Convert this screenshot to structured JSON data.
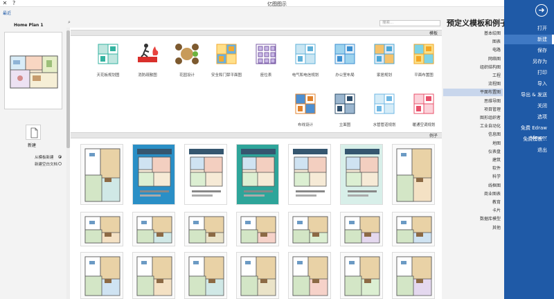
{
  "window": {
    "title": "亿图图示",
    "close_glyph": "✕",
    "help_glyph": "?"
  },
  "sidebar": {
    "back_glyph": "➜",
    "items": [
      {
        "label": "打开"
      },
      {
        "label": "新建",
        "active": true
      },
      {
        "label": "保存"
      },
      {
        "label": "另存为"
      },
      {
        "label": "打印"
      },
      {
        "label": "导入"
      },
      {
        "label": "导出 & 发送"
      },
      {
        "label": "关闭"
      },
      {
        "label": "选项"
      },
      {
        "label": "免费 Edraw Viewer"
      },
      {
        "label": "免费模板..."
      },
      {
        "label": "退出"
      }
    ]
  },
  "categories": {
    "heading": "预定义模板和例子",
    "items": [
      "基本绘图",
      "图表",
      "电路",
      "网络图",
      "组织结构图",
      "工程",
      "流程图",
      "平面布置图",
      "思维导图",
      "项目管理",
      "图形组织者",
      "工业自动化",
      "信息图",
      "地图",
      "仪表盘",
      "建筑",
      "软件",
      "科学",
      "线框图",
      "商业图表",
      "教育",
      "卡片",
      "数据库模型",
      "其他"
    ],
    "active_index": 7
  },
  "search": {
    "placeholder": "搜索..."
  },
  "sections": {
    "templates": "模板",
    "examples": "例子"
  },
  "templates": [
    {
      "label": "平面布置图",
      "kind": "floor"
    },
    {
      "label": "家居规划",
      "kind": "home"
    },
    {
      "label": "办公室布局",
      "kind": "office"
    },
    {
      "label": "电气和电信规划",
      "kind": "electric"
    },
    {
      "label": "座位表",
      "kind": "seat"
    },
    {
      "label": "安全和门禁平面图",
      "kind": "security"
    },
    {
      "label": "花园设计",
      "kind": "garden"
    },
    {
      "label": "消防疏散图",
      "kind": "exit"
    },
    {
      "label": "天花板规划图",
      "kind": "ceiling"
    },
    {
      "label": "暖通空调规划",
      "kind": "hvac"
    },
    {
      "label": "水管管道规划",
      "kind": "plumb"
    },
    {
      "label": "立面图",
      "kind": "elev"
    },
    {
      "label": "布线设计",
      "kind": "wire"
    }
  ],
  "left": {
    "link": "最近",
    "preview_title": "Home Plan 1",
    "new_label": "新建",
    "options": [
      {
        "label": "从模板新建",
        "on": true
      },
      {
        "label": "新建空白文档",
        "on": false
      }
    ]
  },
  "colors": {
    "sidebar": "#1f5aa7",
    "active_cat": "#c8d6ec"
  }
}
